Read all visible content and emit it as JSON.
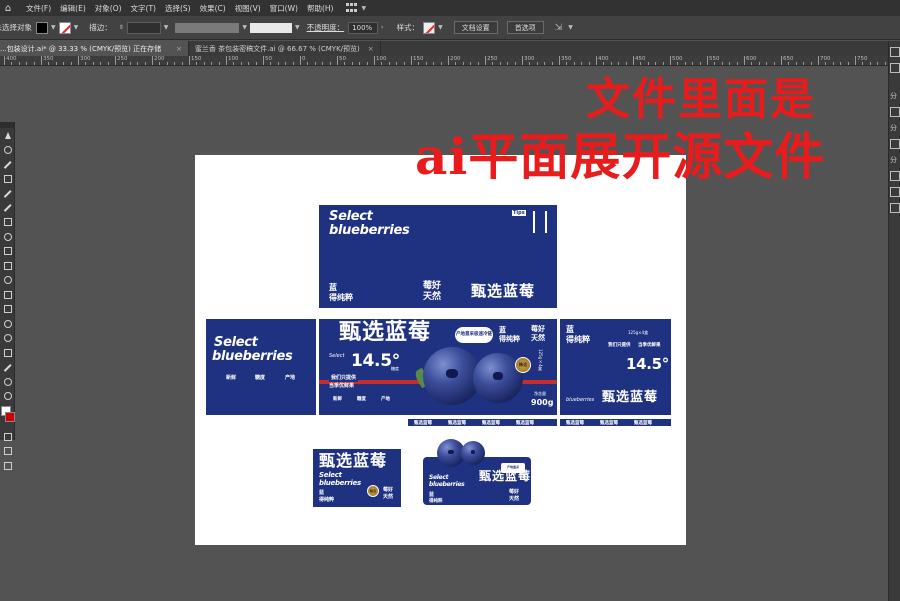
{
  "menubar": {
    "items": [
      "文件(F)",
      "编辑(E)",
      "对象(O)",
      "文字(T)",
      "选择(S)",
      "效果(C)",
      "视图(V)",
      "窗口(W)",
      "帮助(H)"
    ]
  },
  "control_bar": {
    "object_label": "未选择对象",
    "stroke_label": "描边：",
    "opacity_label": "不透明度：",
    "opacity_value": "100%",
    "style_label": "样式：",
    "doc_settings_button": "文档设置",
    "preferences_button": "首选项"
  },
  "tabs": [
    {
      "label": "包装设计.ai* @ 33.33 % (CMYK/预览) 正在存储...",
      "close": "×"
    },
    {
      "label": "蜜兰香 茶包装密稿文件.ai @ 66.67 % (CMYK/预览)",
      "close": "×"
    }
  ],
  "ruler": {
    "labels": [
      "400",
      "350",
      "300",
      "250",
      "200",
      "150",
      "100",
      "50",
      "0",
      "50",
      "100",
      "150",
      "200",
      "250",
      "300",
      "350",
      "400",
      "450",
      "500",
      "550",
      "600",
      "650",
      "700",
      "750"
    ]
  },
  "right_panel": {
    "labels": [
      "分",
      "分",
      "分"
    ]
  },
  "overlay": {
    "line1": "文件里面是",
    "line2": "ai平面展开源文件"
  },
  "design": {
    "en_line1": "Select",
    "en_line2": "blueberries",
    "cn_title": "甄选蓝莓",
    "tips": "Tips",
    "lan": "蓝",
    "de_chun_cui": "得纯粹",
    "mei_hao": "莓好",
    "tian_ran": "天然",
    "origin_pill_1": "产地直采",
    "origin_pill_2": "极速冷链",
    "sugar_value": "14.5°",
    "sugar_unit": "糖度",
    "we_only_1": "我们只提供",
    "we_only_2": "当季优鲜果",
    "net_label": "净含量",
    "net_weight": "900g",
    "spec": "125g×4盒",
    "small_feat_1": "新鲜",
    "small_feat_2": "糖度",
    "small_feat_3": "产地",
    "badge": "精选"
  },
  "colors": {
    "navy": "#1f3281",
    "overlay_red": "#e81c1c",
    "accent_red": "#c62d2d",
    "gold": "#c9a24b"
  }
}
